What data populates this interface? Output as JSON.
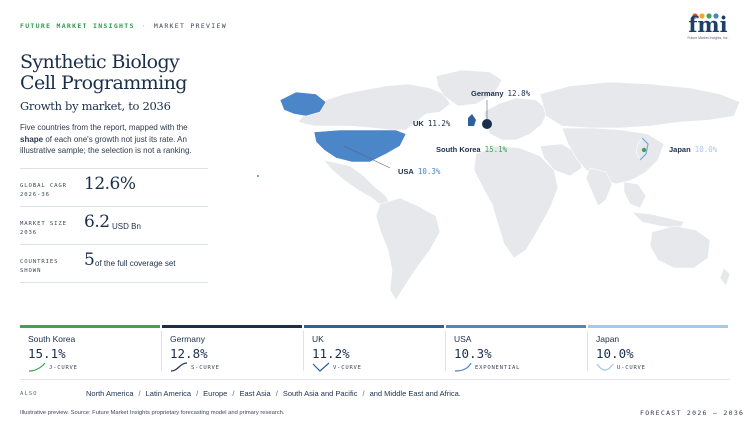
{
  "header": {
    "brand": "FUTURE MARKET INSIGHTS",
    "separator": "·",
    "section": "MARKET PREVIEW"
  },
  "logo": {
    "mark": "fmi",
    "tagline": "Future Market Insights, Inc."
  },
  "title": "Synthetic Biology Cell Programming",
  "subtitle": "Growth by market, to 2036",
  "description": {
    "part1": "Five countries from the report, mapped with the ",
    "bold": "shape",
    "part2": " of each one's growth not just its rate. An illustrative sample; the selection is not a ranking."
  },
  "stats": [
    {
      "label": "GLOBAL CAGR\n2026-36",
      "value": "12.6%",
      "unit": ""
    },
    {
      "label": "MARKET SIZE\n2036",
      "value": "6.2",
      "unit": "USD Bn"
    },
    {
      "label": "COUNTRIES\nSHOWN",
      "value": "5",
      "unit": "of the full coverage set"
    }
  ],
  "map_callouts": [
    {
      "country": "Germany",
      "value": "12.8%"
    },
    {
      "country": "UK",
      "value": "11.2%"
    },
    {
      "country": "South Korea",
      "value": "15.1%"
    },
    {
      "country": "Japan",
      "value": "10.0%"
    },
    {
      "country": "USA",
      "value": "10.3%"
    }
  ],
  "cards": [
    {
      "country": "South Korea",
      "value": "15.1%",
      "shape": "J-CURVE",
      "color": "#3aa655"
    },
    {
      "country": "Germany",
      "value": "12.8%",
      "shape": "S-CURVE",
      "color": "#1b2f4b"
    },
    {
      "country": "UK",
      "value": "11.2%",
      "shape": "V-CURVE",
      "color": "#2f5f9e"
    },
    {
      "country": "USA",
      "value": "10.3%",
      "shape": "EXPONENTIAL",
      "color": "#4a86c8"
    },
    {
      "country": "Japan",
      "value": "10.0%",
      "shape": "U-CURVE",
      "color": "#a9c7e8"
    }
  ],
  "also": {
    "label": "ALSO",
    "regions": [
      "North America",
      "Latin America",
      "Europe",
      "East Asia",
      "South Asia and Pacific",
      "and Middle East and Africa."
    ]
  },
  "footer": {
    "note": "Illustrative preview. Source: Future Market Insights proprietary forecasting model and primary research.",
    "forecast": "FORECAST 2026 – 2036"
  },
  "colors": {
    "brand_green": "#2e9a4e",
    "navy": "#1b2f4b",
    "land": "#e6e8ec",
    "usa": "#4a86c8"
  }
}
